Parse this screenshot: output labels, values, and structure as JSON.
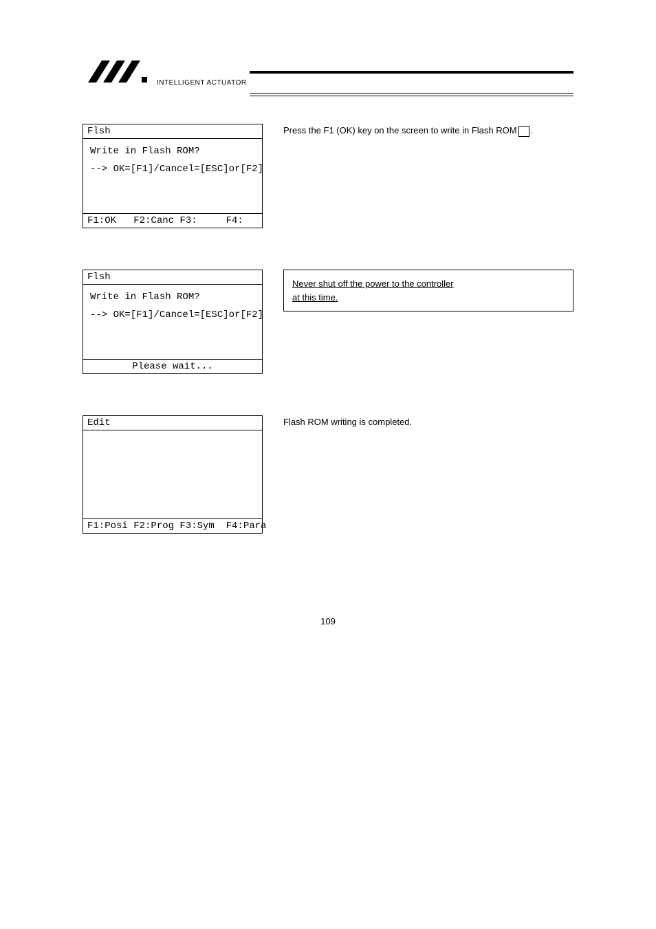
{
  "logo_text": "INTELLIGENT ACTUATOR",
  "screen1": {
    "title": "Flsh",
    "line1": "Write in Flash ROM?",
    "line2": "--> OK=[F1]/Cancel=[ESC]or[F2]",
    "footer": "F1:OK   F2:Canc F3:     F4:"
  },
  "desc1": {
    "prefix": "Press the F1 (OK) key on the screen to write in Flash ROM",
    "suffix": "."
  },
  "screen2": {
    "title": "Flsh",
    "line1": "Write in Flash ROM?",
    "line2": "--> OK=[F1]/Cancel=[ESC]or[F2]",
    "footer": "Please wait..."
  },
  "note": {
    "line1": "Never shut off the power to the controller",
    "line2": "at this time."
  },
  "screen3": {
    "title": "Edit",
    "footer": "F1:Posi F2:Prog F3:Sym  F4:Para"
  },
  "desc3": "Flash ROM writing is completed.",
  "page_number": "109"
}
